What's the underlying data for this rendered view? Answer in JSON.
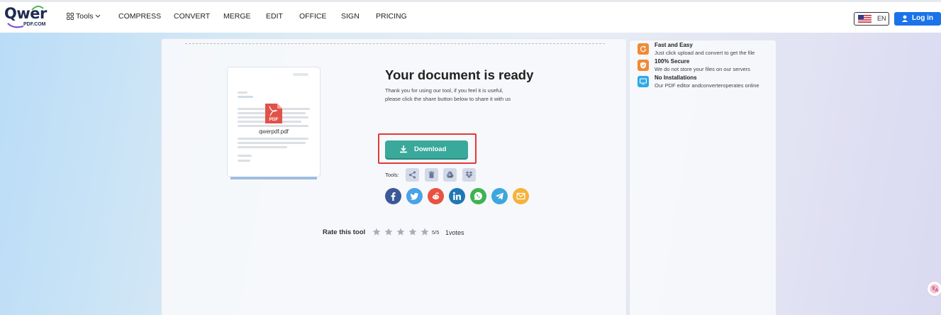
{
  "header": {
    "logo_main": "Qwer",
    "logo_sub": "PDF.COM",
    "nav": [
      {
        "label": "Tools",
        "name": "nav-tools"
      },
      {
        "label": "COMPRESS",
        "name": "nav-compress"
      },
      {
        "label": "CONVERT",
        "name": "nav-convert"
      },
      {
        "label": "MERGE",
        "name": "nav-merge"
      },
      {
        "label": "EDIT",
        "name": "nav-edit"
      },
      {
        "label": "OFFICE",
        "name": "nav-office"
      },
      {
        "label": "SIGN",
        "name": "nav-sign"
      },
      {
        "label": "PRICING",
        "name": "nav-pricing"
      }
    ],
    "lang": "EN",
    "login": "Log in"
  },
  "result": {
    "file_name": "qwerpdf.pdf",
    "pdf_badge": "PDF",
    "title": "Your document is ready",
    "desc_line1": "Thank you for using our tool, if you feel it is useful,",
    "desc_line2": "please click the share button below to share it with us",
    "download": "Download",
    "tools_label": "Tools:",
    "tool_icons": [
      "share-icon",
      "trash-icon",
      "google-drive-icon",
      "dropbox-icon"
    ],
    "social_icons": [
      {
        "name": "facebook-icon",
        "color": "#3b5998"
      },
      {
        "name": "twitter-icon",
        "color": "#4aa3e6"
      },
      {
        "name": "reddit-icon",
        "color": "#e8523f"
      },
      {
        "name": "linkedin-icon",
        "color": "#1f78b4"
      },
      {
        "name": "whatsapp-icon",
        "color": "#3fb34f"
      },
      {
        "name": "telegram-icon",
        "color": "#3ea6dd"
      },
      {
        "name": "email-icon",
        "color": "#f4b33a"
      }
    ]
  },
  "rating": {
    "label": "Rate this tool",
    "stars": 5,
    "score": "5/5",
    "votes": "1votes"
  },
  "features": [
    {
      "title": "Fast and Easy",
      "desc": "Just click upload and convert to get the file",
      "icon": "refresh-icon",
      "color": "#f08a35"
    },
    {
      "title": "100% Secure",
      "desc": "We do not store your files on our servers",
      "icon": "shield-icon",
      "color": "#f08a35"
    },
    {
      "title": "No Installations",
      "desc": "Our PDF editor andconverteroperates online",
      "icon": "monitor-icon",
      "color": "#2fa9e6"
    }
  ],
  "colors": {
    "accent": "#1a73e8",
    "download": "#39a99b",
    "highlight": "#e23a3a"
  }
}
